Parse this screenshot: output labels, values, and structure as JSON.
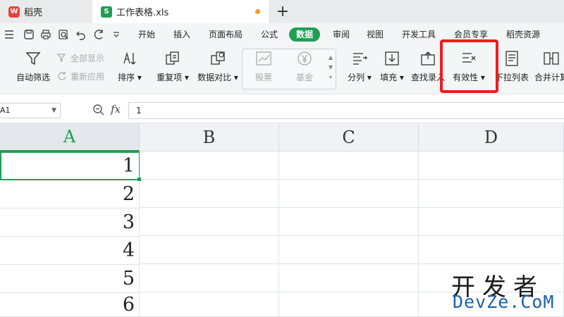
{
  "tabs": {
    "app": {
      "icon": "wps-logo-icon",
      "label": "稻壳"
    },
    "file": {
      "icon": "spreadsheet-icon",
      "label": "工作表格.xls",
      "unsaved_dot_color": "#f0a020"
    },
    "new_tab": "+"
  },
  "menu": {
    "quick_access": [
      "menu-icon",
      "save-icon",
      "print-icon",
      "print-preview-icon",
      "undo-icon",
      "redo-icon",
      "dropdown-icon"
    ],
    "items": [
      "开始",
      "插入",
      "页面布局",
      "公式",
      "数据",
      "审阅",
      "视图",
      "开发工具",
      "会员专享",
      "稻壳资源"
    ],
    "active": "数据",
    "accent": "#1f9d55"
  },
  "ribbon": {
    "auto_filter": "自动筛选",
    "show_all": "全部显示",
    "reapply": "重新应用",
    "sort": "排序",
    "duplicates": "重复项",
    "compare": "数据对比",
    "stock": "股票",
    "fund": "基金",
    "split_column": "分列",
    "fill": "填充",
    "lookup_entry": "查找录入",
    "validation": "有效性",
    "dropdown_list": "下拉列表",
    "merge_calc": "合并计算",
    "highlight_color": "#ee1c1c"
  },
  "formula_bar": {
    "name_box": "A1",
    "fx": "fx",
    "value": "1"
  },
  "grid": {
    "columns": [
      "A",
      "B",
      "C",
      "D"
    ],
    "selected_column": "A",
    "column_a_values": [
      "1",
      "2",
      "3",
      "4",
      "5",
      "6"
    ]
  },
  "watermark": {
    "cn": "开发者",
    "en": "DevZe.CoM"
  }
}
